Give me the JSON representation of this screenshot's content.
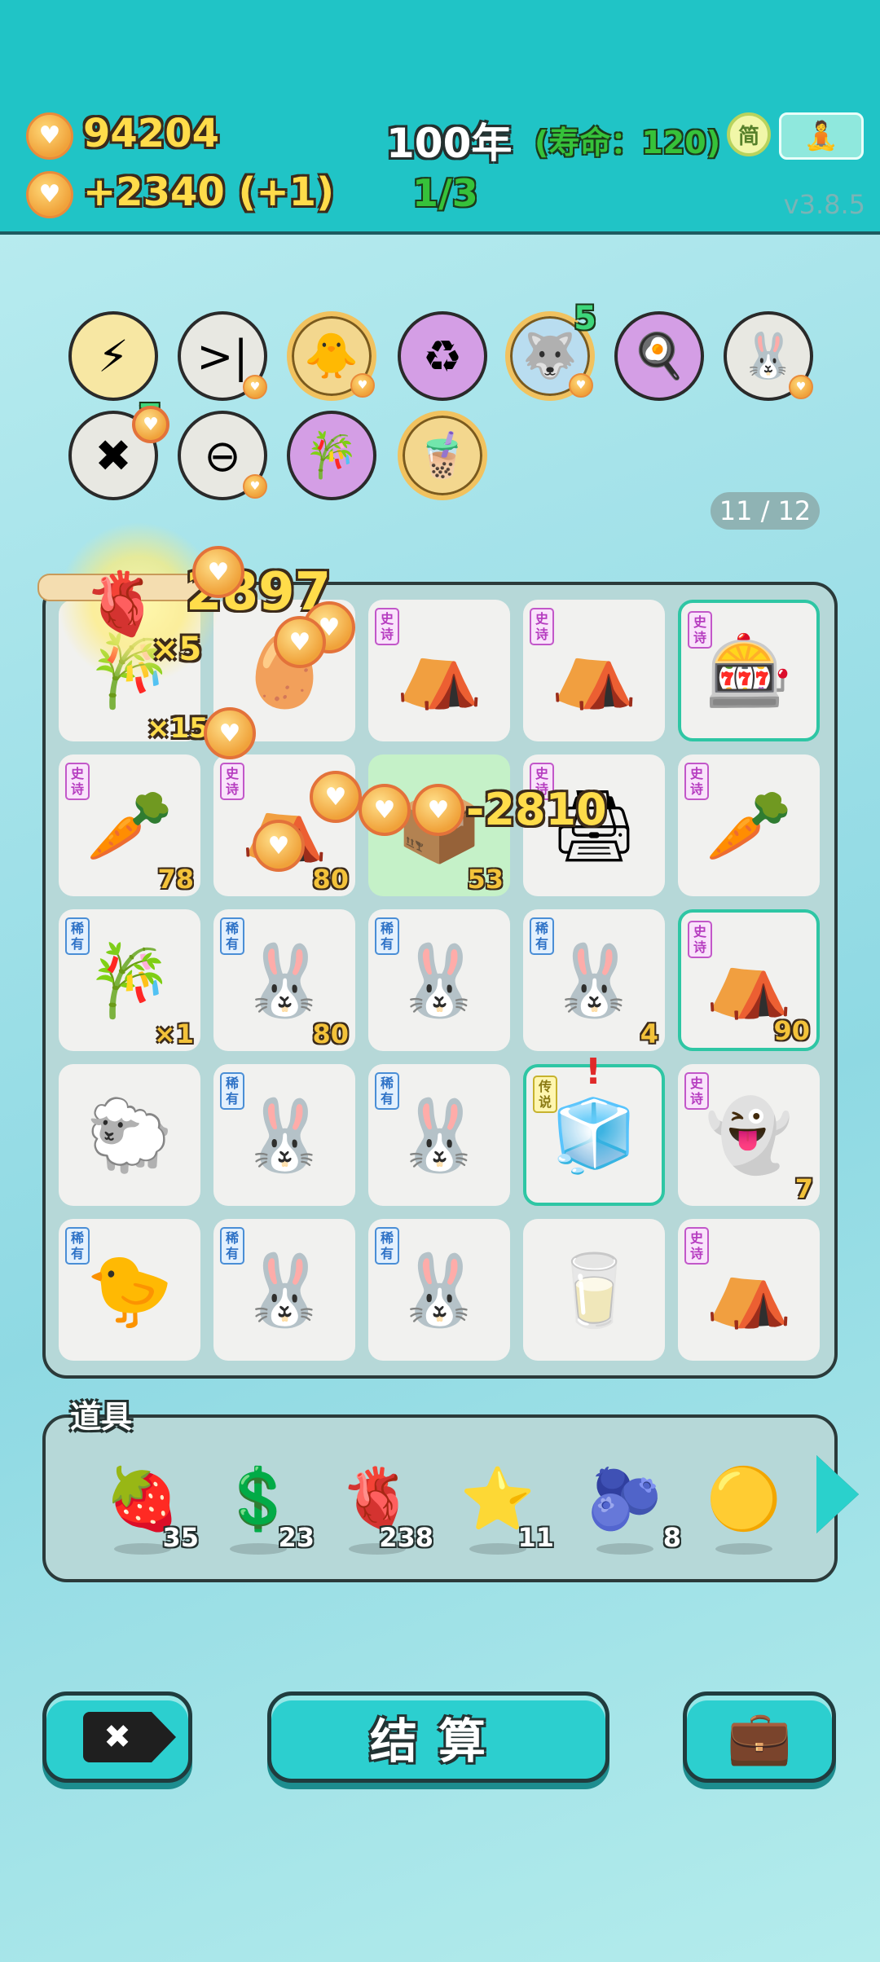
{
  "header": {
    "coins": "94204",
    "income": "+2340 (+1)",
    "year": "100年",
    "lifespan": "(寿命：120)",
    "progress": "1/3",
    "simplified_label": "简",
    "version": "v3.8.5"
  },
  "pins": [
    {
      "name": "lightning-pin",
      "icon": "⚡",
      "bg": "#f7e7a3"
    },
    {
      "name": "skip-pin",
      "icon": ">|",
      "bg": "#e8e8e2"
    },
    {
      "name": "chick-egg-pin",
      "icon": "🐥",
      "bg": "#f3d78e"
    },
    {
      "name": "recycle-pin",
      "icon": "♻",
      "bg": "#d49ee5"
    },
    {
      "name": "husky-pin",
      "icon": "🐺",
      "bg": "#b9ddf0",
      "badge": "5"
    },
    {
      "name": "fried-egg-pin",
      "icon": "🍳",
      "bg": "#d49ee5"
    },
    {
      "name": "rabbit-pin",
      "icon": "🐰",
      "bg": "#e8e8e2"
    },
    {
      "name": "remove-tag-pin",
      "icon": "✖",
      "bg": "#e8e8e2",
      "badge": "7"
    },
    {
      "name": "no-entry-pin",
      "icon": "⊖",
      "bg": "#e8e8e2"
    },
    {
      "name": "bamboo-ruler-pin",
      "icon": "🎋",
      "bg": "#d49ee5"
    },
    {
      "name": "bubble-tea-pin",
      "icon": "🧋",
      "bg": "#f3d78e"
    }
  ],
  "slots_counter": "11 / 12",
  "effects": {
    "gain": "2897",
    "x5": "×5",
    "x15": "×15",
    "loss": "-2810"
  },
  "board": [
    [
      {
        "icon": "🎋",
        "tag": "",
        "num": ""
      },
      {
        "icon": "🥚",
        "tag": "",
        "num": ""
      },
      {
        "icon": "⛺",
        "tag": "史诗",
        "num": ""
      },
      {
        "icon": "⛺",
        "tag": "史诗",
        "num": ""
      },
      {
        "icon": "🎰",
        "tag": "史诗",
        "num": "",
        "highlight": true
      }
    ],
    [
      {
        "icon": "🥕",
        "tag": "史诗",
        "num": "78"
      },
      {
        "icon": "⛺",
        "tag": "史诗",
        "num": "80"
      },
      {
        "icon": "📦",
        "tag": "",
        "num": "53",
        "green": true
      },
      {
        "icon": "🖨",
        "tag": "史诗",
        "num": ""
      },
      {
        "icon": "🥕",
        "tag": "史诗",
        "num": ""
      }
    ],
    [
      {
        "icon": "🎋",
        "tag": "稀有",
        "num": "×1"
      },
      {
        "icon": "🐰",
        "tag": "稀有",
        "num": "80"
      },
      {
        "icon": "🐰",
        "tag": "稀有",
        "num": ""
      },
      {
        "icon": "🐰",
        "tag": "稀有",
        "num": "4"
      },
      {
        "icon": "⛺",
        "tag": "史诗",
        "num": "90",
        "highlight": true
      }
    ],
    [
      {
        "icon": "🐑",
        "tag": "",
        "num": ""
      },
      {
        "icon": "🐰",
        "tag": "稀有",
        "num": ""
      },
      {
        "icon": "🐰",
        "tag": "稀有",
        "num": ""
      },
      {
        "icon": "🧊",
        "tag": "传说",
        "num": "",
        "highlight": true
      },
      {
        "icon": "👻",
        "tag": "史诗",
        "num": "7"
      }
    ],
    [
      {
        "icon": "🐤",
        "tag": "稀有",
        "num": ""
      },
      {
        "icon": "🐰",
        "tag": "稀有",
        "num": ""
      },
      {
        "icon": "🐰",
        "tag": "稀有",
        "num": ""
      },
      {
        "icon": "🥛",
        "tag": "",
        "num": ""
      },
      {
        "icon": "⛺",
        "tag": "史诗",
        "num": ""
      }
    ]
  ],
  "props_title": "道具",
  "props": [
    {
      "name": "lychee",
      "icon": "🍓",
      "count": "35"
    },
    {
      "name": "dollar-coin",
      "icon": "💲",
      "count": "23"
    },
    {
      "name": "liver",
      "icon": "🫀",
      "count": "238"
    },
    {
      "name": "star",
      "icon": "⭐",
      "count": "11"
    },
    {
      "name": "blueberry",
      "icon": "🫐",
      "count": "8"
    },
    {
      "name": "gold-ball",
      "icon": "🟡",
      "count": ""
    }
  ],
  "buttons": {
    "remove_icon": "✖",
    "settle": "结算",
    "bag_icon": "💼"
  },
  "colors": {
    "topbar": "#20c4c6",
    "coin_text": "#ffdc4a",
    "accent": "#2ccfcf"
  }
}
